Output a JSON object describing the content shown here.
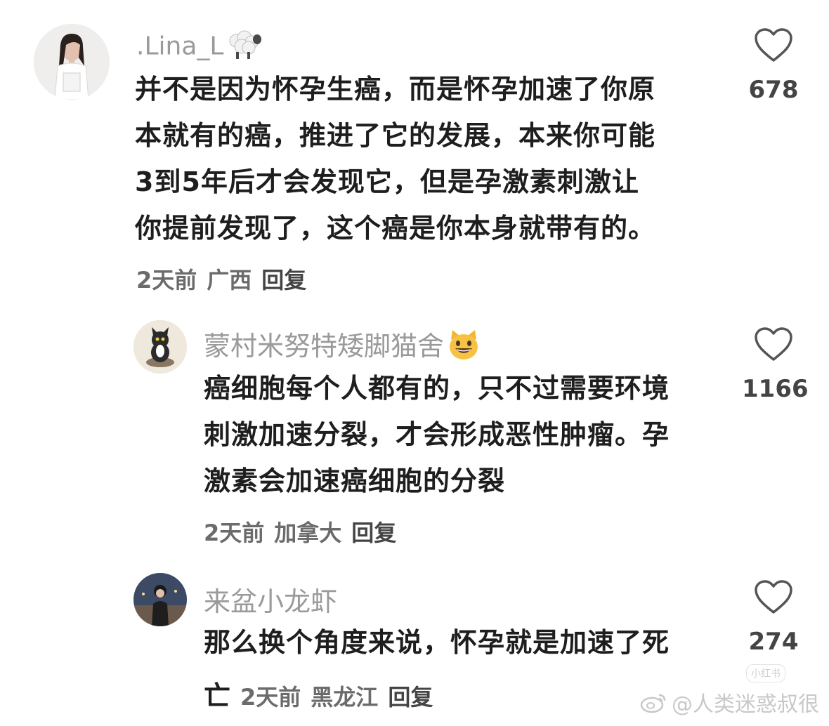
{
  "comments": [
    {
      "username": ".Lina_L",
      "username_emoji": "sheep-emoji",
      "text_lines": [
        "并不是因为怀孕生癌，而是怀孕加速了你原",
        "本就有的癌，推进了它的发展，本来你可能",
        "3到5年后才会发现它，但是孕激素刺激让",
        "你提前发现了，这个癌是你本身就带有的。"
      ],
      "time": "2天前",
      "location": "广西",
      "reply_label": "回复",
      "likes": "678"
    },
    {
      "username": "蒙村米努特矮脚猫舍",
      "username_emoji": "grinning-cat-emoji",
      "text_lines": [
        "癌细胞每个人都有的，只不过需要环境",
        "刺激加速分裂，才会形成恶性肿瘤。孕",
        "激素会加速癌细胞的分裂"
      ],
      "time": "2天前",
      "location": "加拿大",
      "reply_label": "回复",
      "likes": "1166"
    },
    {
      "username": "来盆小龙虾",
      "text_lines": [
        "那么换个角度来说，怀孕就是加速了死"
      ],
      "text_tail": "亡",
      "time": "2天前",
      "location": "黑龙江",
      "reply_label": "回复",
      "likes": "274"
    }
  ],
  "watermark": {
    "text": "@人类迷惑叔很",
    "small_mark": "小红书"
  }
}
